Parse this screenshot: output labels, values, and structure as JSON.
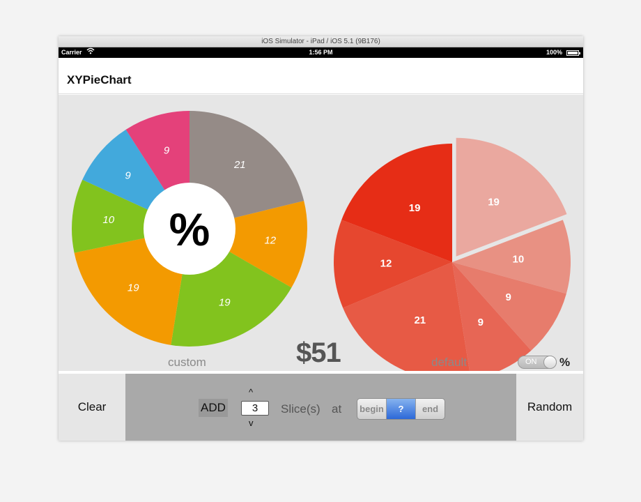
{
  "window": {
    "title": "iOS Simulator - iPad / iOS 5.1 (9B176)"
  },
  "status_bar": {
    "carrier": "Carrier",
    "time": "1:56 PM",
    "battery": "100%",
    "wifi_icon": "wifi-icon",
    "battery_icon": "battery-icon"
  },
  "nav": {
    "title": "XYPieChart"
  },
  "charts": {
    "custom": {
      "caption": "custom",
      "center_label": "%",
      "slices": [
        {
          "label": "21",
          "value": 21,
          "color": "#958b87"
        },
        {
          "label": "12",
          "value": 12,
          "color": "#f39a01"
        },
        {
          "label": "19",
          "value": 19,
          "color": "#82c31e"
        },
        {
          "label": "19",
          "value": 19,
          "color": "#f39a01"
        },
        {
          "label": "10",
          "value": 10,
          "color": "#82c31e"
        },
        {
          "label": "9",
          "value": 9,
          "color": "#42a9dc"
        },
        {
          "label": "9",
          "value": 9,
          "color": "#e4417a"
        }
      ]
    },
    "default": {
      "caption": "default",
      "selected_index": 0,
      "slices": [
        {
          "label": "19",
          "value": 19,
          "color": "#eaa89f"
        },
        {
          "label": "10",
          "value": 10,
          "color": "#e89183"
        },
        {
          "label": "9",
          "value": 9,
          "color": "#e77c6c"
        },
        {
          "label": "9",
          "value": 9,
          "color": "#e76655"
        },
        {
          "label": "21",
          "value": 21,
          "color": "#e75a45"
        },
        {
          "label": "12",
          "value": 12,
          "color": "#e6472f"
        },
        {
          "label": "19",
          "value": 19,
          "color": "#e62d16"
        }
      ]
    }
  },
  "total": "$51",
  "percent_toggle": {
    "state_label": "ON",
    "suffix": "%"
  },
  "toolbar": {
    "clear": "Clear",
    "random": "Random",
    "add": "ADD",
    "stepper_up": "^",
    "stepper_down": "v",
    "count": "3",
    "slices_label": "Slice(s)",
    "at_label": "at",
    "segments": [
      "begin",
      "?",
      "end"
    ],
    "selected_segment": 1
  }
}
